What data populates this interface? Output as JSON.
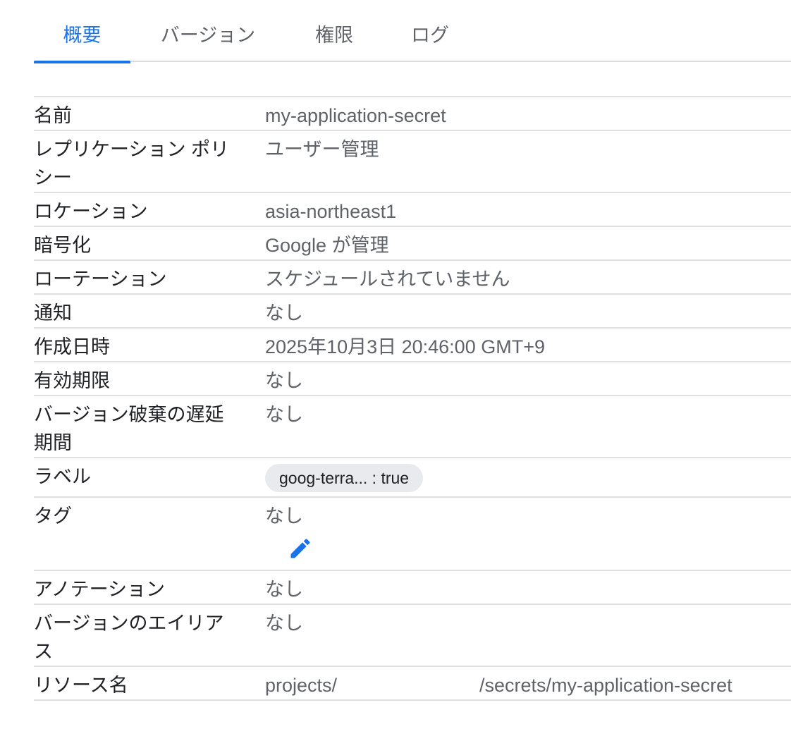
{
  "tabs": [
    {
      "label": "概要",
      "active": true
    },
    {
      "label": "バージョン",
      "active": false
    },
    {
      "label": "権限",
      "active": false
    },
    {
      "label": "ログ",
      "active": false
    }
  ],
  "details": {
    "name": {
      "label": "名前",
      "value": "my-application-secret"
    },
    "replication": {
      "label": "レプリケーション ポリシー",
      "value": "ユーザー管理"
    },
    "location": {
      "label": "ロケーション",
      "value": "asia-northeast1"
    },
    "encryption": {
      "label": "暗号化",
      "value": "Google が管理"
    },
    "rotation": {
      "label": "ローテーション",
      "value": "スケジュールされていません"
    },
    "notification": {
      "label": "通知",
      "value": "なし"
    },
    "created": {
      "label": "作成日時",
      "value": "2025年10月3日 20:46:00 GMT+9"
    },
    "expiration": {
      "label": "有効期限",
      "value": "なし"
    },
    "destroy_delay": {
      "label": "バージョン破棄の遅延期間",
      "value": "なし"
    },
    "labels": {
      "label": "ラベル",
      "chip": "goog-terra... : true"
    },
    "tags": {
      "label": "タグ",
      "value": "なし",
      "edit_icon": "pencil-icon"
    },
    "annotations": {
      "label": "アノテーション",
      "value": "なし"
    },
    "version_alias": {
      "label": "バージョンのエイリアス",
      "value": "なし"
    },
    "resource_name": {
      "label": "リソース名",
      "prefix": "projects/",
      "suffix": "/secrets/my-application-secret"
    }
  },
  "colors": {
    "accent": "#1a73e8",
    "text_primary": "#202124",
    "text_secondary": "#5f6368",
    "divider": "#e0e0e0",
    "chip_bg": "#e8eaed"
  }
}
